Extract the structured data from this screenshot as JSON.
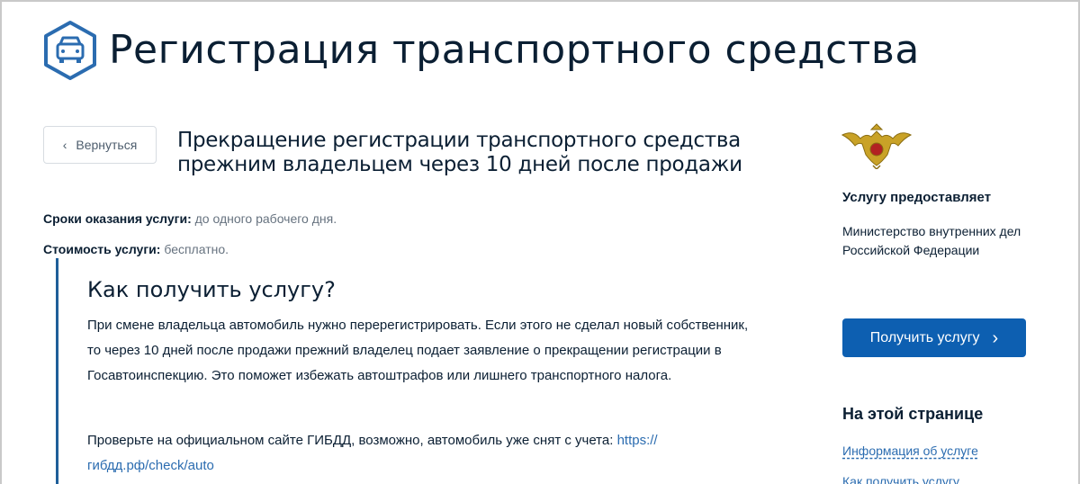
{
  "header": {
    "title": "Регистрация транспортного средства",
    "logo_icon": "car-hexagon-icon",
    "accent_color": "#2b6cb0"
  },
  "back_button": {
    "label": "Вернуться",
    "icon": "chevron-left-icon"
  },
  "service": {
    "title_line1": "Прекращение регистрации транспортного средства",
    "title_line2": "прежним владельцем через 10 дней после продажи"
  },
  "meta": {
    "terms_label": "Сроки оказания услуги:",
    "terms_value": "до одного рабочего дня.",
    "cost_label": "Стоимость услуги:",
    "cost_value": "бесплатно."
  },
  "content": {
    "heading": "Как получить услугу?",
    "paragraph": "При смене владельца автомобиль нужно перерегистрировать. Если этого не сделал новый собственник, то через 10 дней после продажи прежний владелец подает заявление о прекращении регистрации в Госавтоинспекцию. Это поможет избежать автоштрафов или лишнего транспортного налога.",
    "check_text": "Проверьте на официальном сайте ГИБДД, возможно, автомобиль уже снят с учета: ",
    "check_link": "https://гибдд.рф/check/auto"
  },
  "sidebar": {
    "emblem_icon": "double-headed-eagle-emblem-icon",
    "provider_label": "Услугу предоставляет",
    "provider_name": "Министерство внутренних дел Российской Федерации",
    "get_service_button": "Получить услугу",
    "toc_title": "На этой странице",
    "toc_items": [
      "Информация об услуге",
      "Как получить услугу"
    ]
  },
  "colors": {
    "primary_button": "#0d5fb1",
    "link": "#2b6cb0",
    "text": "#0b1f33",
    "muted": "#66727f"
  }
}
